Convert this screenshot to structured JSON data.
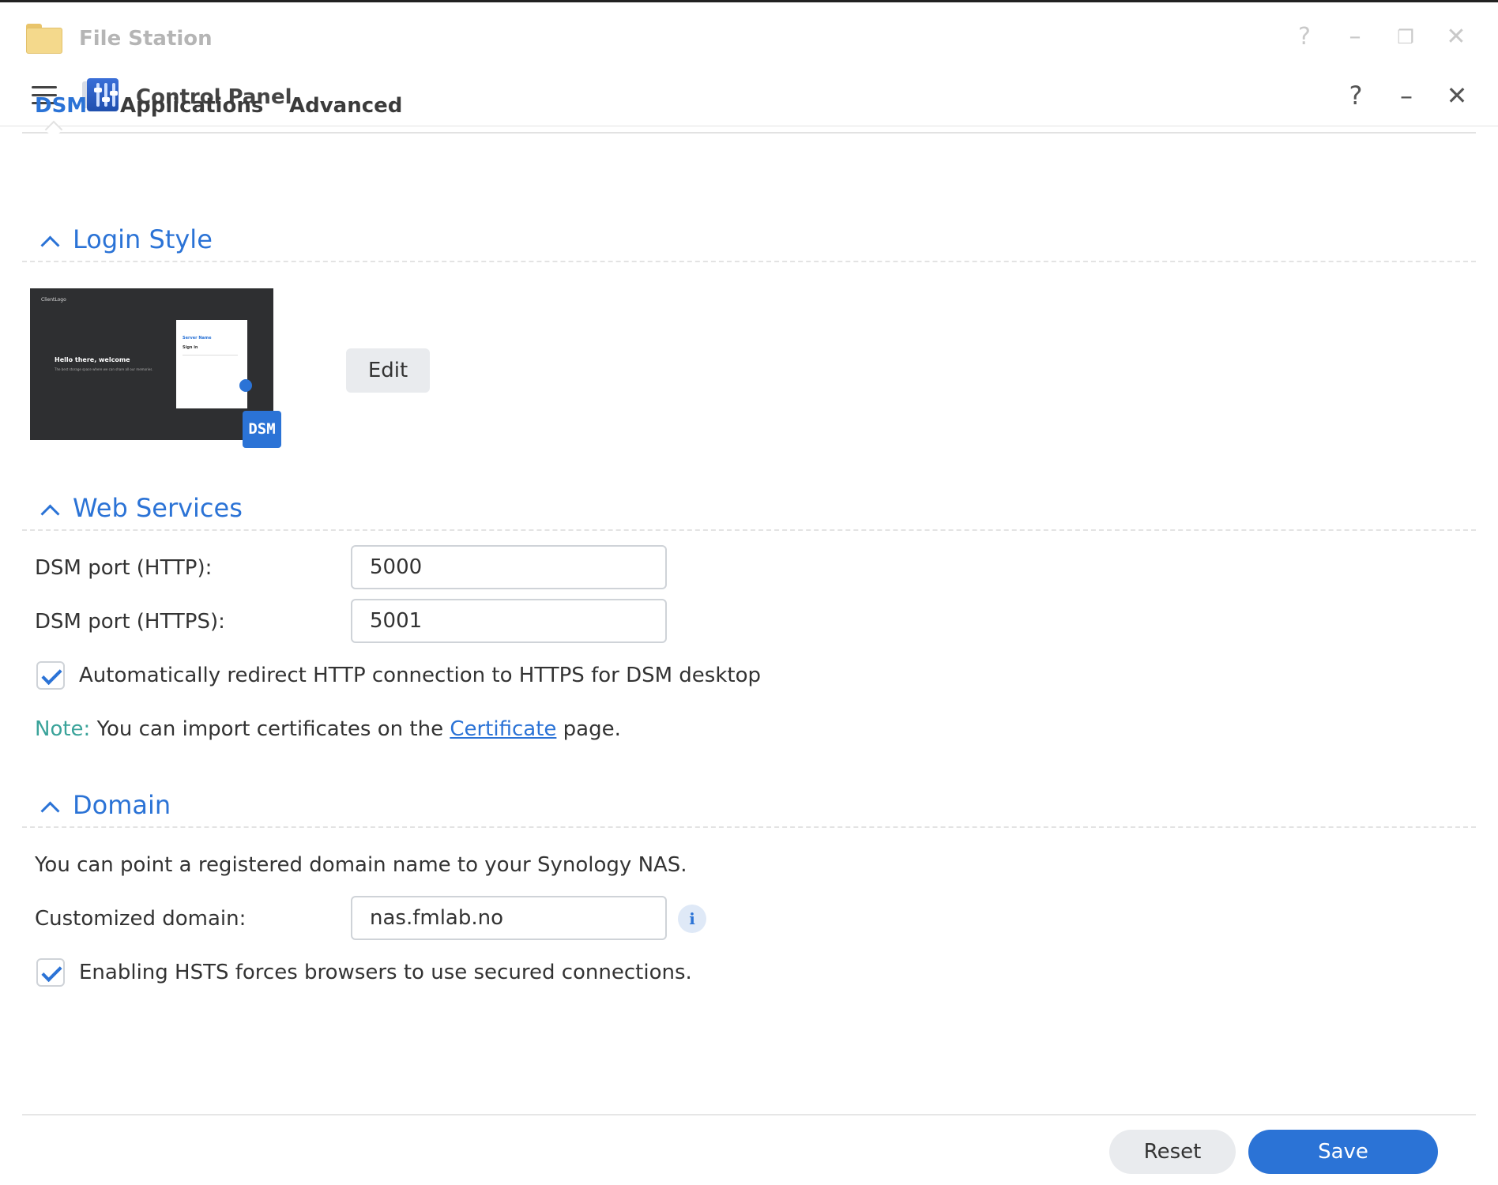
{
  "background_window": {
    "title": "File Station",
    "controls": {
      "help": "?",
      "minimize": "–",
      "restore": "❐",
      "close": "✕"
    }
  },
  "window": {
    "title": "Control Panel",
    "controls": {
      "help": "?",
      "minimize": "–",
      "close": "✕"
    }
  },
  "tabs": [
    {
      "label": "DSM",
      "active": true
    },
    {
      "label": "Applications",
      "active": false
    },
    {
      "label": "Advanced",
      "active": false
    }
  ],
  "sections": {
    "login_style": {
      "title": "Login Style",
      "preview": {
        "logo_text": "ClientLogo",
        "headline": "Hello there, welcome",
        "subtext": "The best storage space where we can share all our memories.",
        "card_server": "Server Name",
        "card_signin": "Sign in",
        "badge": "DSM"
      },
      "edit_label": "Edit"
    },
    "web_services": {
      "title": "Web Services",
      "http_label": "DSM port (HTTP):",
      "http_value": "5000",
      "https_label": "DSM port (HTTPS):",
      "https_value": "5001",
      "redirect_label": "Automatically redirect HTTP connection to HTTPS for DSM desktop",
      "redirect_checked": true,
      "note_key": "Note:",
      "note_text_before": " You can import certificates on the ",
      "note_link": "Certificate",
      "note_text_after": " page."
    },
    "domain": {
      "title": "Domain",
      "description": "You can point a registered domain name to your Synology NAS.",
      "custom_label": "Customized domain:",
      "custom_value": "nas.fmlab.no",
      "info_icon": "i",
      "hsts_label": "Enabling HSTS forces browsers to use secured connections.",
      "hsts_checked": true
    }
  },
  "footer": {
    "reset_label": "Reset",
    "save_label": "Save"
  },
  "colors": {
    "accent": "#2b73d6",
    "note": "#3aa39a"
  }
}
